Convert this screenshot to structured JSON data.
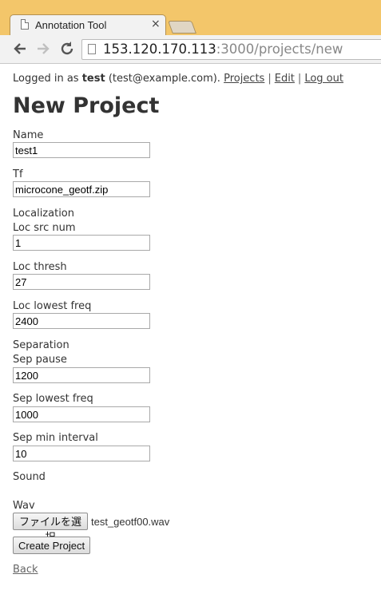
{
  "browser": {
    "tab_title": "Annotation Tool",
    "tab_close": "×",
    "url_host": "153.120.170.113",
    "url_rest": ":3000/projects/new"
  },
  "header": {
    "logged_in_prefix": "Logged in as",
    "username": "test",
    "email": "(test@example.com).",
    "links": {
      "projects": "Projects",
      "edit": "Edit",
      "logout": "Log out"
    },
    "separator": "|"
  },
  "page_title": "New Project",
  "form": {
    "name": {
      "label": "Name",
      "value": "test1"
    },
    "tf": {
      "label": "Tf",
      "value": "microcone_geotf.zip"
    },
    "localization": {
      "heading": "Localization",
      "src_num": {
        "label": "Loc src num",
        "value": "1"
      },
      "thresh": {
        "label": "Loc thresh",
        "value": "27"
      },
      "lowest_freq": {
        "label": "Loc lowest freq",
        "value": "2400"
      }
    },
    "separation": {
      "heading": "Separation",
      "pause": {
        "label": "Sep pause",
        "value": "1200"
      },
      "lowest_freq": {
        "label": "Sep lowest freq",
        "value": "1000"
      },
      "min_interval": {
        "label": "Sep min interval",
        "value": "10"
      }
    },
    "sound": {
      "heading": "Sound",
      "wav_label": "Wav",
      "file_button": "ファイルを選択",
      "file_name": "test_geotf00.wav"
    },
    "submit": "Create Project"
  },
  "back_link": "Back"
}
